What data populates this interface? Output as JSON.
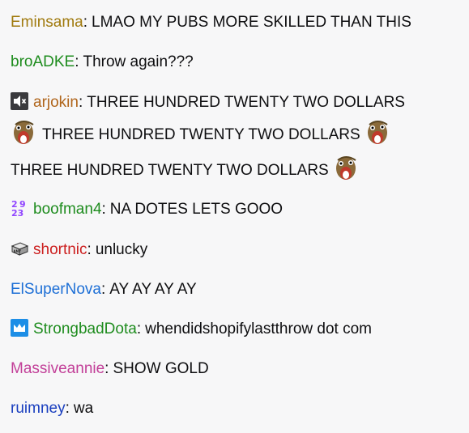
{
  "messages": [
    {
      "user": "Eminsama",
      "color": "#a07a0e",
      "text": "LMAO MY PUBS MORE SKILLED THAN THIS"
    },
    {
      "user": "broADKE",
      "color": "#1e8c1e",
      "text": "Throw again???"
    },
    {
      "user": "arjokin",
      "color": "#b0651b",
      "badge": "muted-speaker-icon",
      "segments": [
        "THREE HUNDRED TWENTY TWO DOLLARS",
        "THREE HUNDRED TWENTY TWO DOLLARS",
        "THREE HUNDRED TWENTY TWO DOLLARS"
      ],
      "emote": "snake-face-emote"
    },
    {
      "user": "boofman4",
      "color": "#1e8c1e",
      "badge": "year-2023-badge-icon",
      "badge_text_top": "2",
      "badge_text_top2": "9",
      "badge_text_bottom": "23",
      "text": "NA DOTES LETS GOOO"
    },
    {
      "user": "shortnic",
      "color": "#cc1f1f",
      "badge": "any-key-icon",
      "badge_text": "ANY",
      "text": "unlucky"
    },
    {
      "user": "ElSuperNova",
      "color": "#1d6fd6",
      "text": "AY AY AY AY"
    },
    {
      "user": "StrongbadDota",
      "color": "#1e8c1e",
      "badge": "crown-subscriber-icon",
      "text": "whendidshopifylastthrow dot com"
    },
    {
      "user": "Massiveannie",
      "color": "#c23f98",
      "text": "SHOW GOLD"
    },
    {
      "user": "ruimney",
      "color": "#1a3fbf",
      "text": "wa"
    }
  ],
  "separator": ":"
}
